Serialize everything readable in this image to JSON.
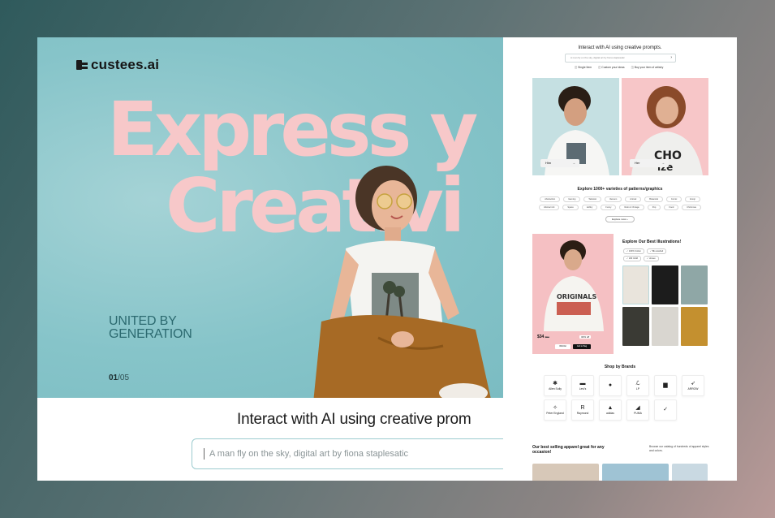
{
  "hero": {
    "logo_text": "custees.ai",
    "headline_line1": "Express y",
    "headline_line2": "Creativi",
    "tagline_line1": "UNITED BY",
    "tagline_line2": "GENERATION",
    "slide_current": "01",
    "slide_total": "/05"
  },
  "prompt": {
    "title": "Interact with AI using creative prom",
    "input_value": "A man fly on the sky, digital art by fiona staplesatic"
  },
  "panel": {
    "title": "Interact with AI using creative prompts.",
    "search_placeholder": "A man fly on the sky, digital art by fiona staplesatic",
    "chips": [
      "Single Item",
      "Custom your ideas",
      "Buy your item of artistry"
    ],
    "him_label": "Him",
    "her_label": "Her",
    "patterns_title": "Explore 1000+ varieties of patterns/graphics",
    "pattern_tags": [
      "Abstraction",
      "Gaming",
      "Tattooist",
      "Vacuum",
      "Animal",
      "Botanical",
      "Comic",
      "Emoji",
      "Abstract Art",
      "Space",
      "Hobby",
      "Funny",
      "Retro & Vintage",
      "Pop",
      "Food",
      "Christmas"
    ],
    "explore_more": "Explore more",
    "illustrations_title": "Explore Our Best Illustrations!",
    "illustration_tags": [
      "100% Cotton",
      "Bio washed",
      "180 GSM",
      "Unisex"
    ],
    "price": "$34",
    "old_price": "$50",
    "discount": "32% off",
    "wishlist_label": "Wishlist",
    "add_to_bag_label": "Add to Bag",
    "brands_title": "Shop by Brands",
    "brands": [
      {
        "name": "Allen Solly",
        "glyph": "✱"
      },
      {
        "name": "Levi's",
        "glyph": "▬"
      },
      {
        "name": "",
        "glyph": "●"
      },
      {
        "name": "LP",
        "glyph": "ℒ"
      },
      {
        "name": "",
        "glyph": "▆"
      },
      {
        "name": "ARROW",
        "glyph": "➶"
      },
      {
        "name": "Peter England",
        "glyph": "✧"
      },
      {
        "name": "Raymond",
        "glyph": "R"
      },
      {
        "name": "adidas",
        "glyph": "▲"
      },
      {
        "name": "PUMA",
        "glyph": "◢"
      },
      {
        "name": "",
        "glyph": "✓"
      }
    ],
    "best_title": "Our best selling apparel great for any occasion!",
    "best_desc": "Browse our catalog of hundreds of apparel styles and colors."
  },
  "colors": {
    "hero_bg": "#86c4c9",
    "headline": "#f7c8c9",
    "tagline": "#2c6a70",
    "pink_tile": "#f7c6c8"
  }
}
